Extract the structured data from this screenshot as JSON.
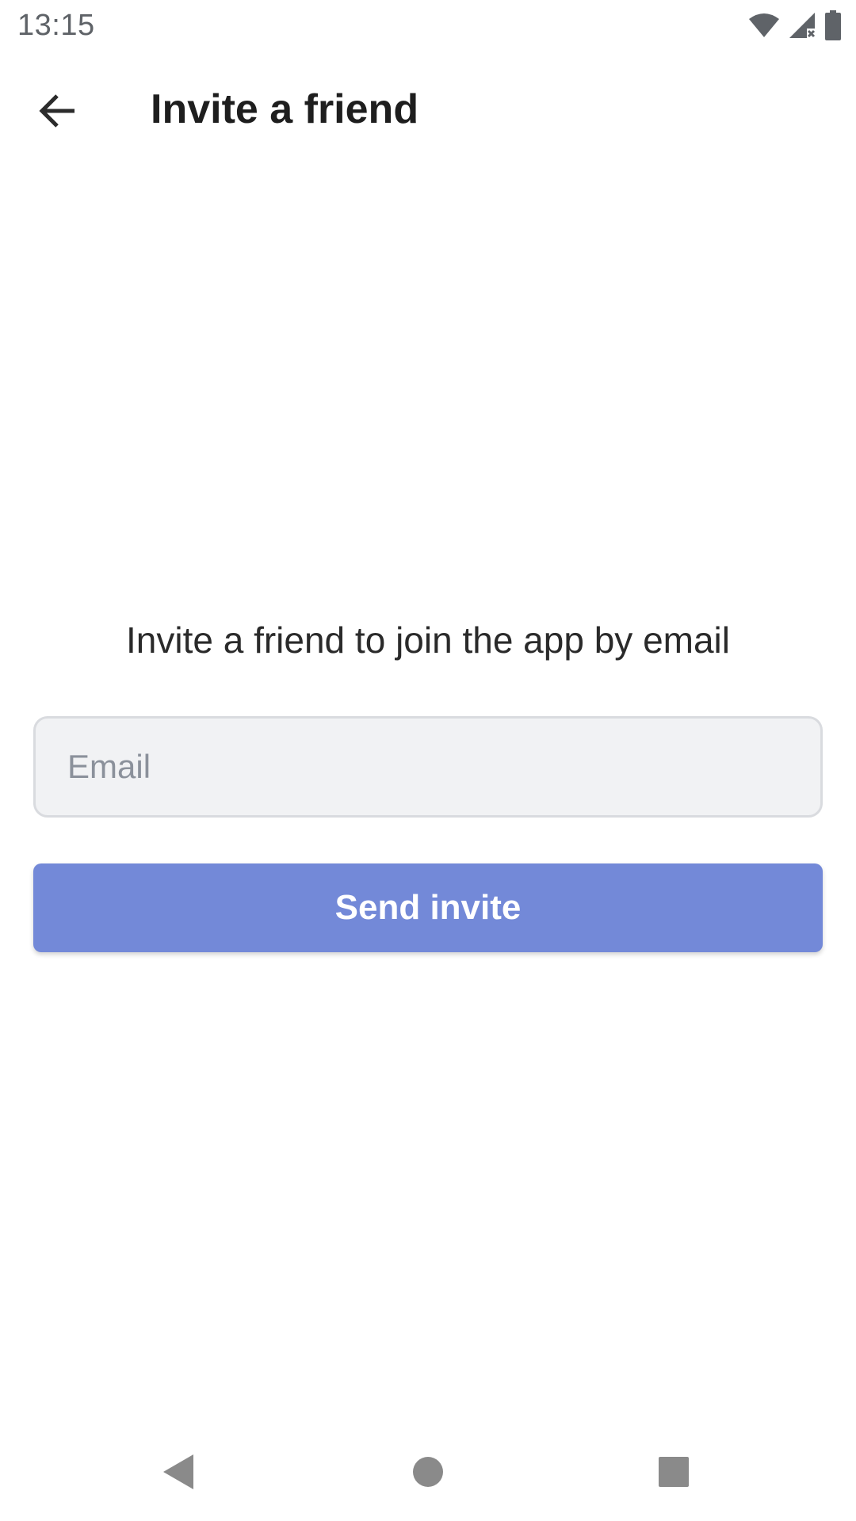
{
  "status_bar": {
    "time": "13:15",
    "icons": [
      "wifi-icon",
      "cellular-signal-icon",
      "battery-icon"
    ]
  },
  "app_bar": {
    "back_icon": "arrow-back-icon",
    "title": "Invite a friend"
  },
  "main": {
    "prompt": "Invite a friend to join the app by email",
    "email_field": {
      "placeholder": "Email",
      "value": ""
    },
    "send_button_label": "Send invite"
  },
  "nav_bar": {
    "icons": [
      "nav-back-icon",
      "nav-home-icon",
      "nav-recents-icon"
    ]
  },
  "colors": {
    "accent": "#7389d8",
    "field_background": "#f1f2f4",
    "field_border": "#d9dbdf",
    "placeholder": "#8b919b",
    "status_gray": "#5f6368"
  }
}
